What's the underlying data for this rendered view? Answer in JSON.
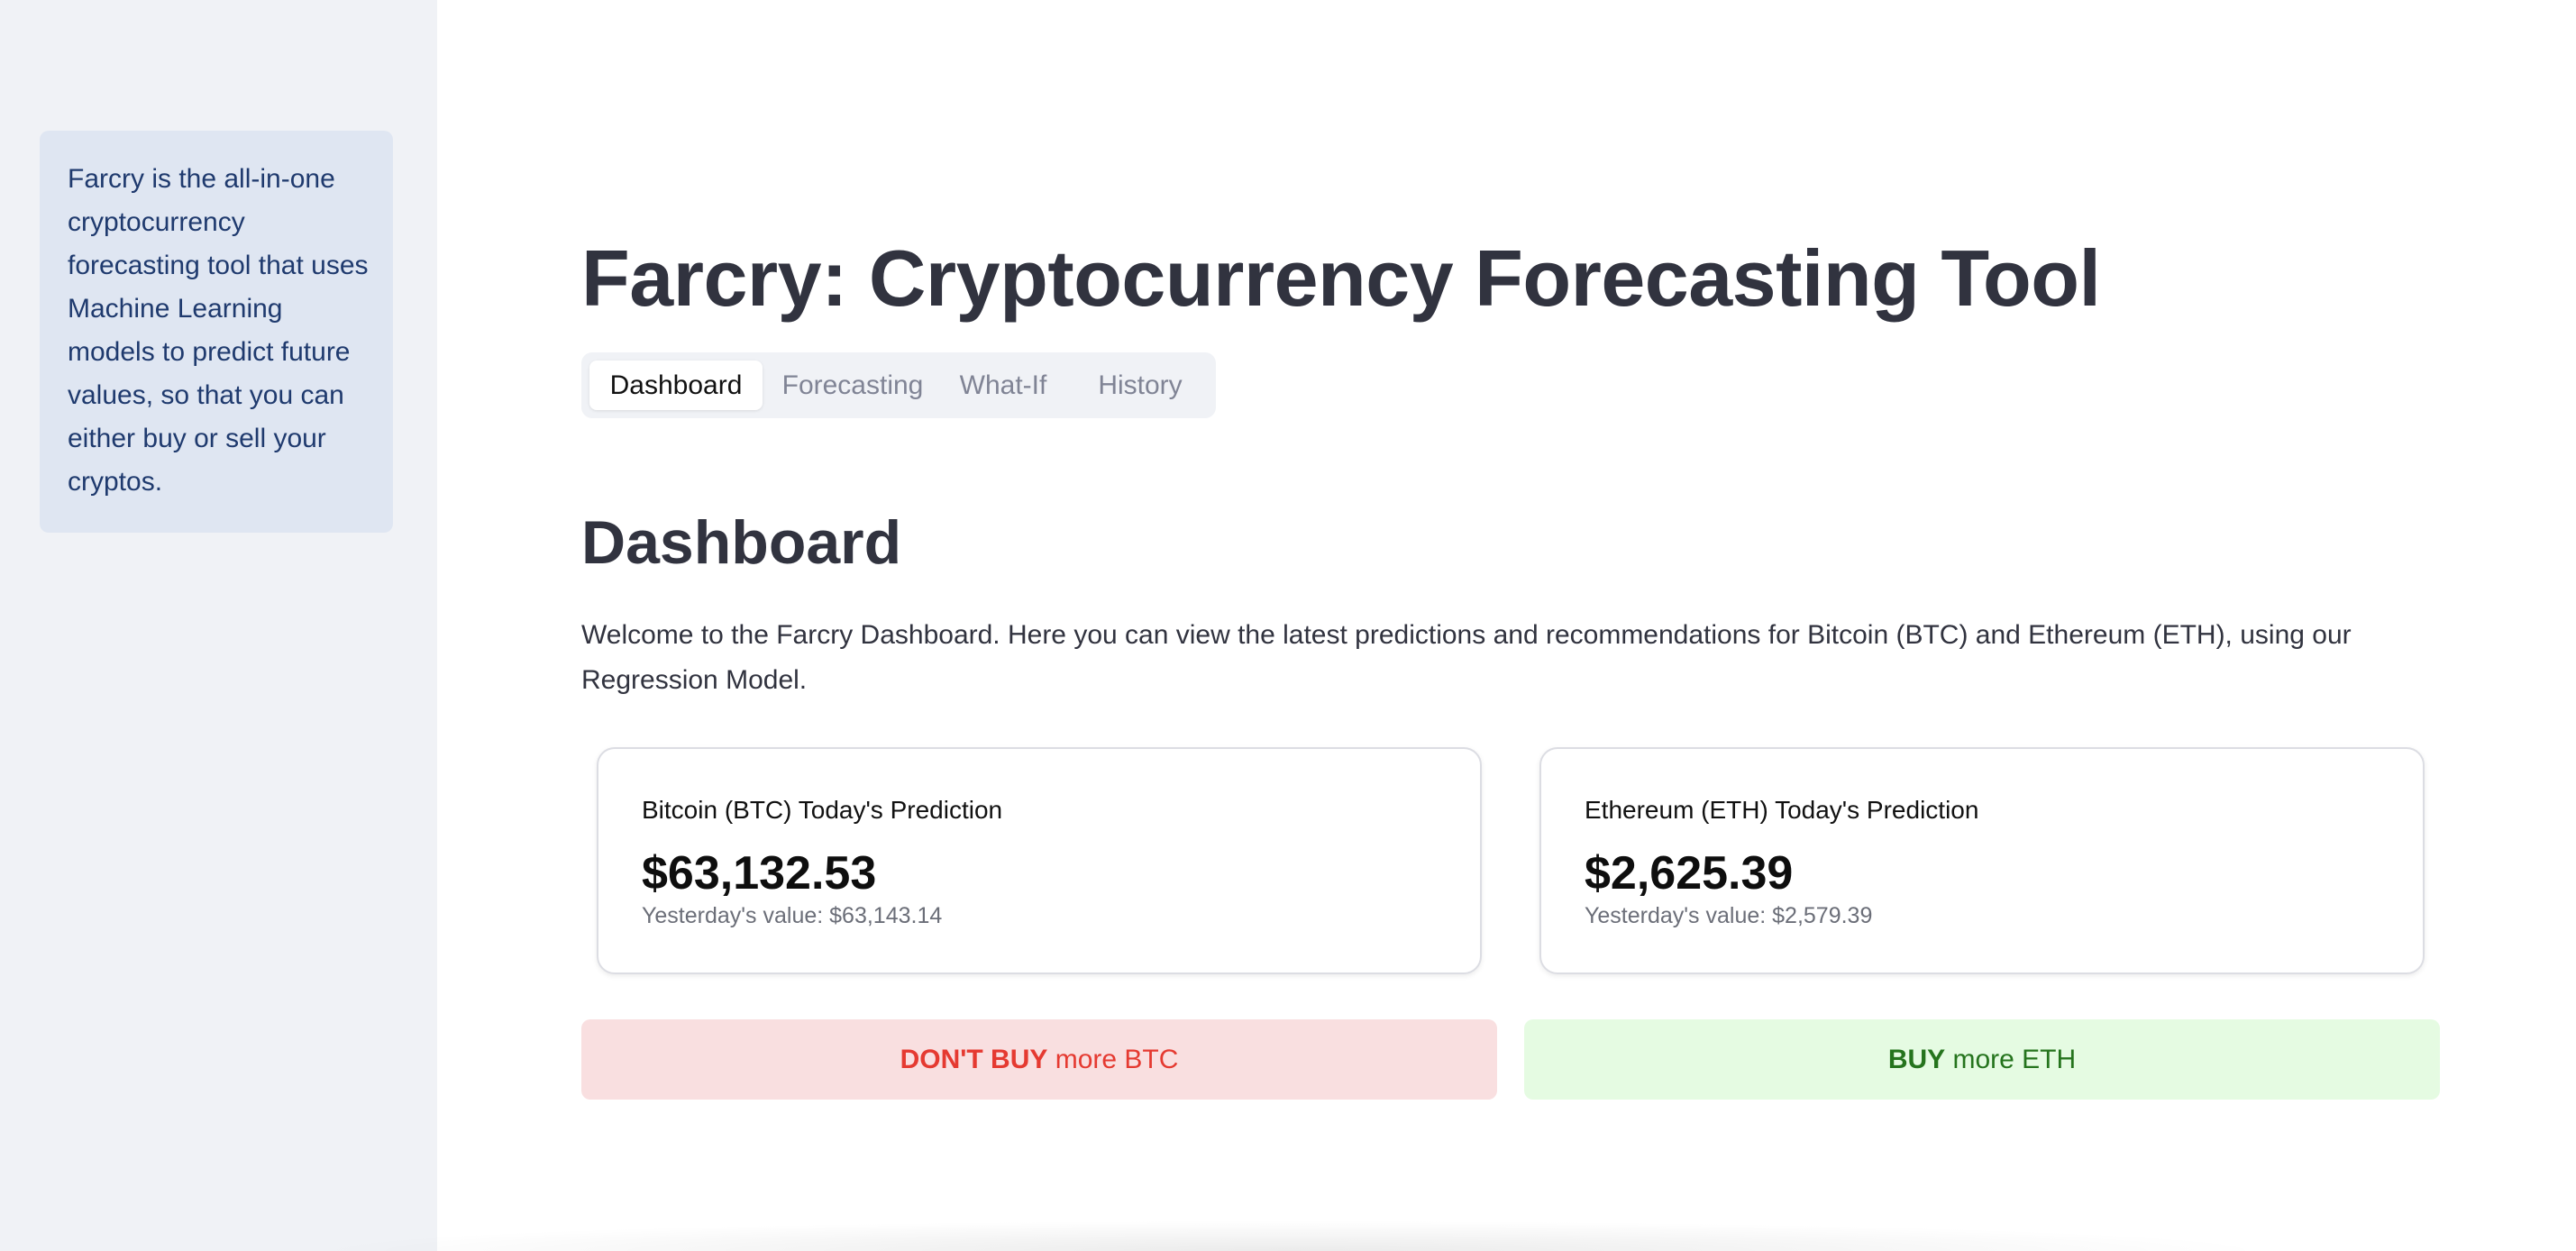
{
  "sidebar": {
    "info_text": "Farcry is the all-in-one cryptocurrency forecasting tool that uses Machine Learning models to predict future values, so that you can either buy or sell your cryptos."
  },
  "main": {
    "title": "Farcry: Cryptocurrency Forecasting Tool",
    "tabs": [
      {
        "label": "Dashboard",
        "active": true
      },
      {
        "label": "Forecasting",
        "active": false
      },
      {
        "label": "What-If",
        "active": false
      },
      {
        "label": "History",
        "active": false
      }
    ],
    "section_heading": "Dashboard",
    "intro": "Welcome to the Farcry Dashboard. Here you can view the latest predictions and recommendations for Bitcoin (BTC) and Ethereum (ETH), using our Regression Model."
  },
  "cards": [
    {
      "label": "Bitcoin (BTC) Today's Prediction",
      "value": "$63,132.53",
      "sub": "Yesterday's value: $63,143.14"
    },
    {
      "label": "Ethereum (ETH) Today's Prediction",
      "value": "$2,625.39",
      "sub": "Yesterday's value: $2,579.39"
    }
  ],
  "recommendations": [
    {
      "strong": "DON'T BUY",
      "rest": " more BTC",
      "status_color": "#e53a31",
      "background": "#f9dfe0"
    },
    {
      "strong": "BUY",
      "rest": " more ETH",
      "status_color": "#25741d",
      "background": "#e5fbe2"
    }
  ]
}
